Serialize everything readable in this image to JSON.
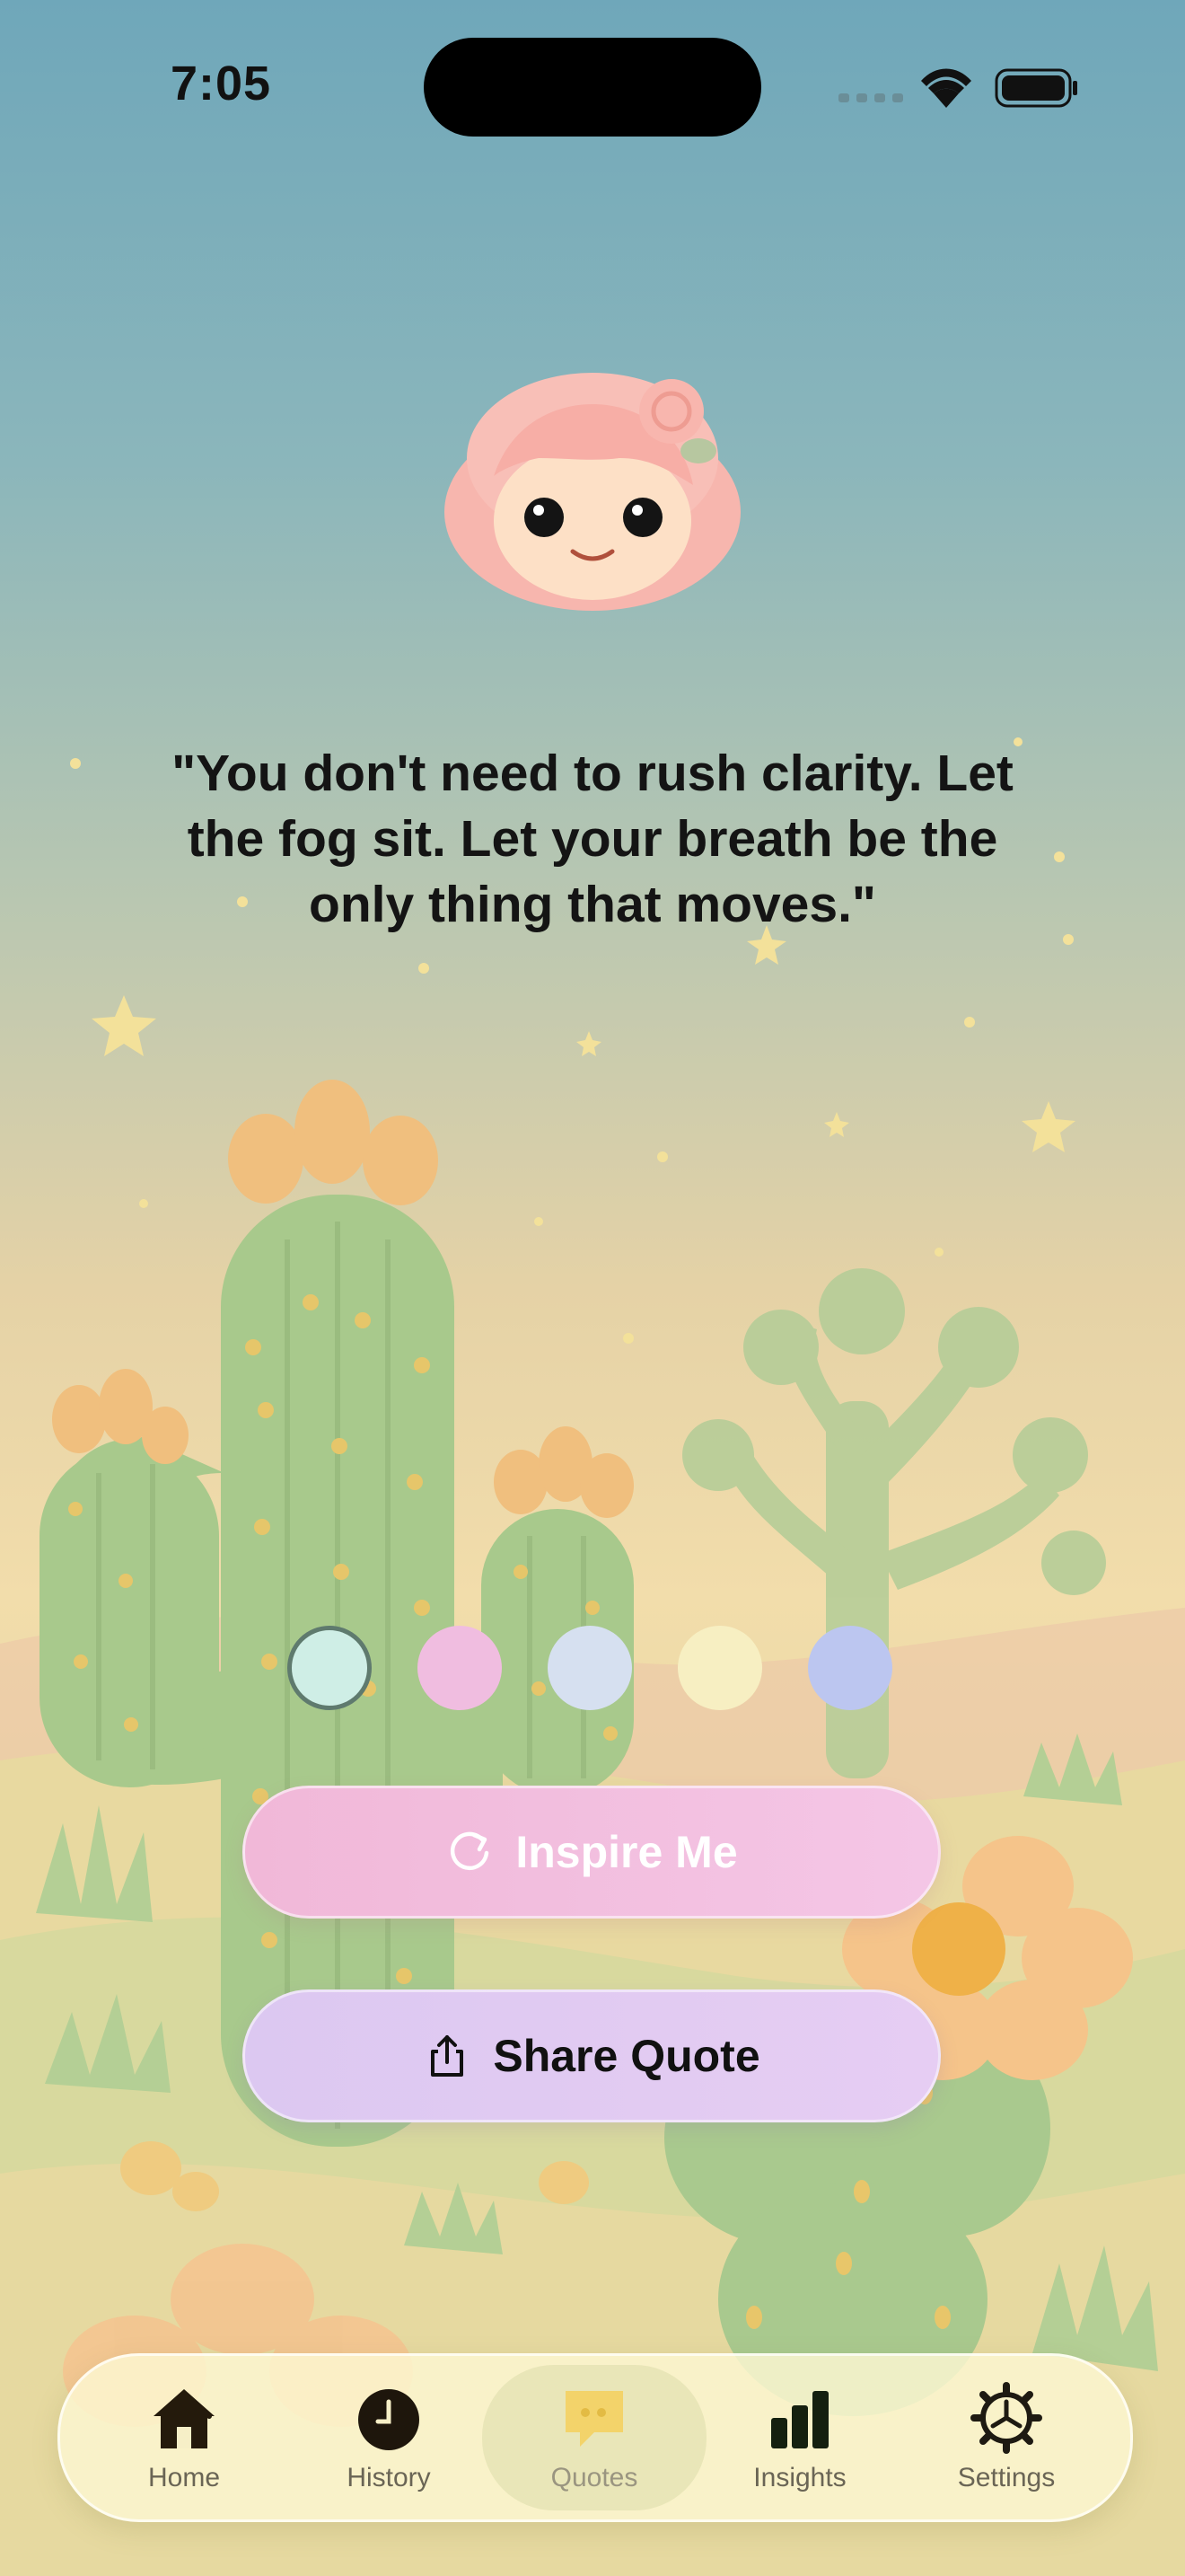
{
  "status_bar": {
    "time": "7:05"
  },
  "quote": {
    "text": "\"You don't need to rush clarity. Let the fog sit. Let your breath be the only thing that moves.\""
  },
  "theme_swatches": [
    {
      "name": "mint",
      "color": "#cfeee6",
      "selected": true
    },
    {
      "name": "pink",
      "color": "#f0bde0",
      "selected": false
    },
    {
      "name": "lavender-blue",
      "color": "#d6e0f0",
      "selected": false
    },
    {
      "name": "cream",
      "color": "#f7efc2",
      "selected": false
    },
    {
      "name": "periwinkle",
      "color": "#bcc6f0",
      "selected": false
    }
  ],
  "actions": {
    "inspire_label": "Inspire Me",
    "share_label": "Share Quote"
  },
  "tab_bar": {
    "items": [
      {
        "label": "Home",
        "icon": "house-icon"
      },
      {
        "label": "History",
        "icon": "clock-icon"
      },
      {
        "label": "Quotes",
        "icon": "speech-bubble-icon",
        "active": true
      },
      {
        "label": "Insights",
        "icon": "bar-chart-icon"
      },
      {
        "label": "Settings",
        "icon": "gear-icon"
      }
    ]
  },
  "colors": {
    "accent_pink": "#f1b8d8",
    "accent_lavender": "#dcc8f1",
    "quotes_active": "#f3d36a"
  }
}
